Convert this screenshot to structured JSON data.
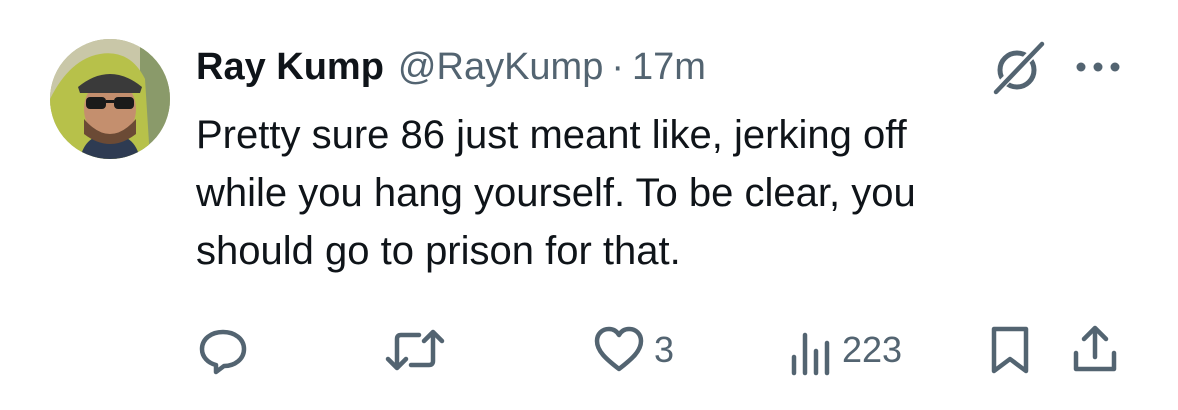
{
  "author": {
    "name": "Ray Kump",
    "handle": "@RayKump",
    "separator": "·",
    "time": "17m",
    "avatar_icon": "avatar-photo"
  },
  "tweet": {
    "lines": [
      "Pretty sure 86 just meant like, jerking off",
      "while you hang yourself. To be clear, you",
      "should go to prison for that."
    ]
  },
  "actions": {
    "reply": {
      "icon": "reply-icon",
      "count": ""
    },
    "retweet": {
      "icon": "retweet-icon",
      "count": ""
    },
    "like": {
      "icon": "heart-icon",
      "count": "3"
    },
    "views": {
      "icon": "views-icon",
      "count": "223"
    },
    "bookmark": {
      "icon": "bookmark-icon"
    },
    "share": {
      "icon": "share-icon"
    }
  },
  "colors": {
    "text": "#0f1419",
    "secondary": "#536471",
    "background": "#ffffff"
  }
}
